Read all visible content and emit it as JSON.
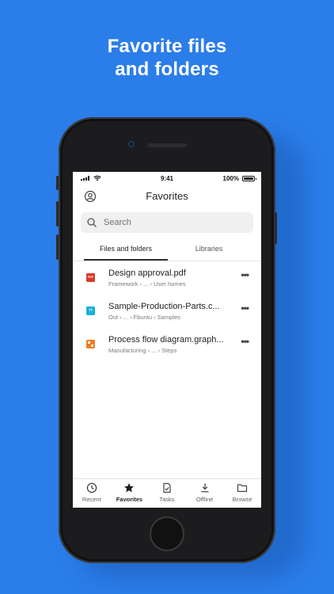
{
  "headline": {
    "line1": "Favorite files",
    "line2": "and folders"
  },
  "status_bar": {
    "time": "9:41",
    "battery": "100%"
  },
  "header": {
    "title": "Favorites"
  },
  "search": {
    "placeholder": "Search"
  },
  "tabs": [
    {
      "label": "Files and folders",
      "active": true
    },
    {
      "label": "Libraries",
      "active": false
    }
  ],
  "files": [
    {
      "name": "Design approval.pdf",
      "path": "Framework › ... › User homes",
      "icon": "pdf-icon"
    },
    {
      "name": "Sample-Production-Parts.c...",
      "path": "Out › ... › Fbuntu › Samples",
      "icon": "code-file-icon"
    },
    {
      "name": "Process flow diagram.graph...",
      "path": "Manufacturing › ... › Steps",
      "icon": "diagram-icon"
    }
  ],
  "more_glyph": "•••",
  "bottom_nav": [
    {
      "label": "Recent",
      "icon": "clock-icon",
      "active": false
    },
    {
      "label": "Favorites",
      "icon": "star-icon",
      "active": true
    },
    {
      "label": "Tasks",
      "icon": "task-icon",
      "active": false
    },
    {
      "label": "Offline",
      "icon": "download-icon",
      "active": false
    },
    {
      "label": "Browse",
      "icon": "folder-icon",
      "active": false
    }
  ],
  "colors": {
    "background": "#2b7de9",
    "pdf": "#d93b2b",
    "code": "#1bb0d9",
    "diagram": "#f07b1f"
  }
}
